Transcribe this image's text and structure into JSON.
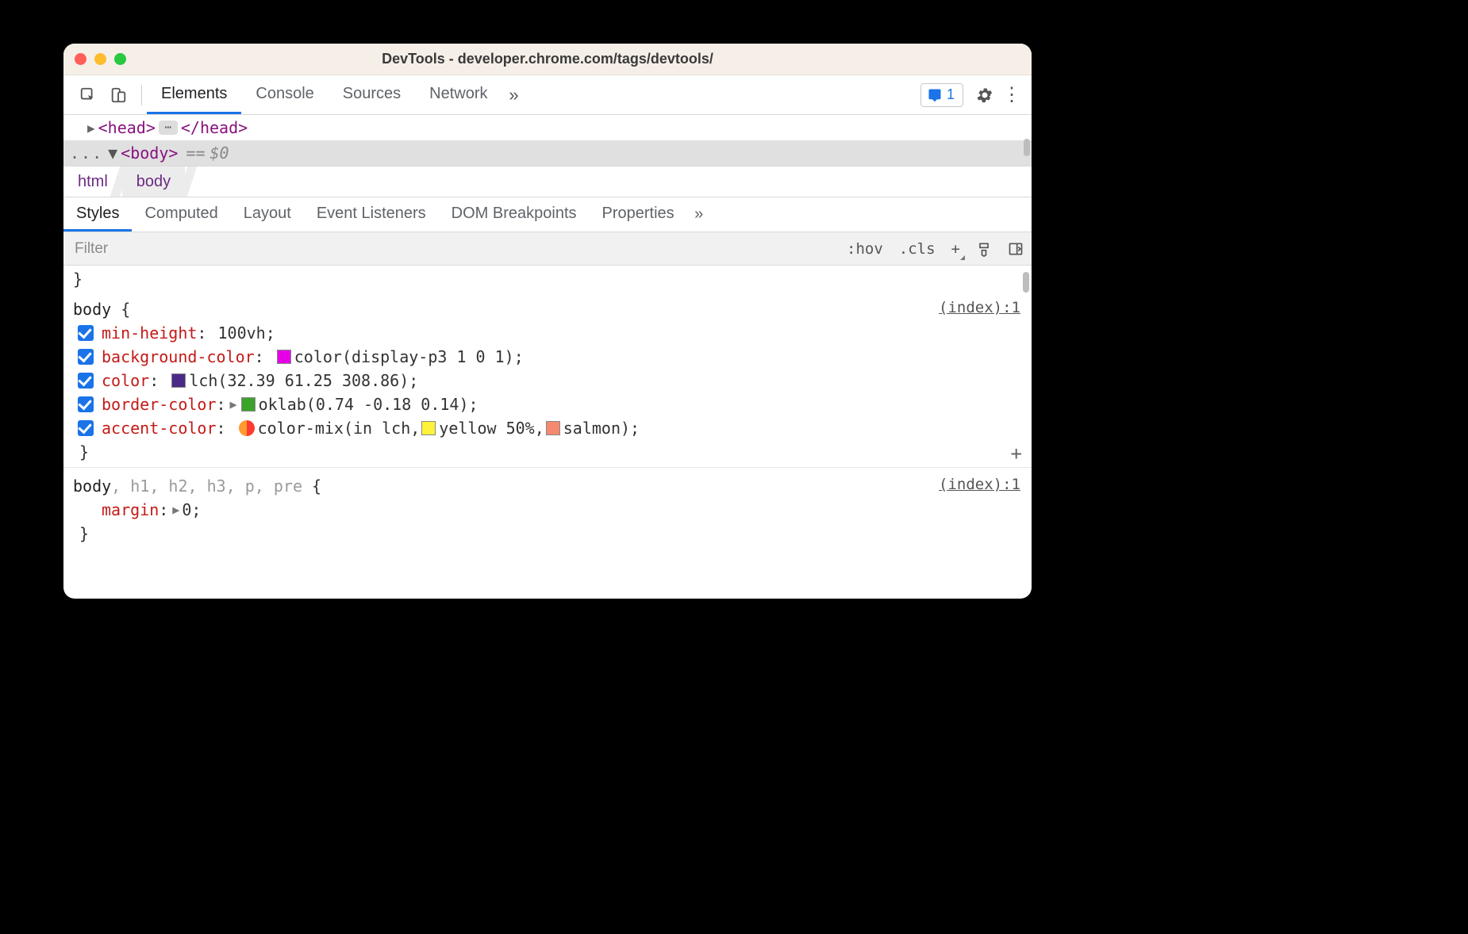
{
  "titlebar": {
    "title": "DevTools - developer.chrome.com/tags/devtools/"
  },
  "toolbar": {
    "tabs": [
      "Elements",
      "Console",
      "Sources",
      "Network"
    ],
    "active_tab": 0,
    "more_glyph": "»",
    "issues_count": "1"
  },
  "dom": {
    "head_open": "<head>",
    "head_close": "</head>",
    "body_tag": "<body>",
    "eq": "==",
    "var": "$0",
    "pre_dots": "..."
  },
  "breadcrumb": {
    "items": [
      "html",
      "body"
    ],
    "active": 1
  },
  "subtabs": {
    "items": [
      "Styles",
      "Computed",
      "Layout",
      "Event Listeners",
      "DOM Breakpoints",
      "Properties"
    ],
    "active": 0,
    "more_glyph": "»"
  },
  "filter": {
    "placeholder": "Filter",
    "hov": ":hov",
    "cls": ".cls",
    "plus": "+"
  },
  "css": {
    "rule1": {
      "selector": "body",
      "open": "{",
      "close": "}",
      "source": "(index):1",
      "decls": [
        {
          "prop": "min-height",
          "value": "100vh"
        },
        {
          "prop": "background-color",
          "value": "color(display-p3 1 0 1)"
        },
        {
          "prop": "color",
          "value": "lch(32.39 61.25 308.86)"
        },
        {
          "prop": "border-color",
          "value": "oklab(0.74 -0.18 0.14)"
        },
        {
          "prop": "accent-color",
          "value_parts": {
            "fn": "color-mix(in lch, ",
            "mid": "yellow 50%, ",
            "end": "salmon)"
          }
        }
      ]
    },
    "rule2": {
      "selector_main": "body",
      "selector_dim": ", h1, h2, h3, p, pre",
      "open": "{",
      "close": "}",
      "source": "(index):1",
      "decl": {
        "prop": "margin",
        "value": "0"
      }
    },
    "top_close": "}"
  }
}
